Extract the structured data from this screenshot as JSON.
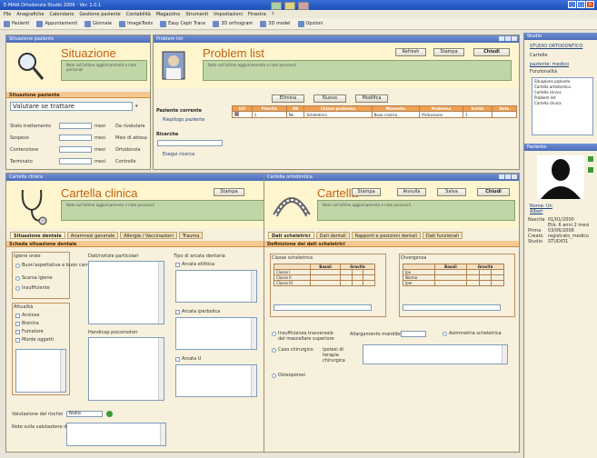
{
  "window": {
    "title": "E-MAIA Ortodonzia Studio 2006 - Ver. 1.0.1"
  },
  "menu": [
    "File",
    "Anagrafiche",
    "Calendario",
    "Gestione paziente",
    "Contabilità",
    "Magazzino",
    "Strumenti",
    "Impostazioni",
    "Finestra",
    "?"
  ],
  "toolbar": [
    "Pazienti",
    "Appuntamenti",
    "Giornale",
    "ImageTools",
    "Easy Ceph Trace",
    "3D orthogram",
    "3D model",
    "Opzioni"
  ],
  "situazione": {
    "pane_title": "Situazione paziente",
    "title": "Situazione paziente",
    "note": "Note sull'ultimo aggiornamento e note personali",
    "section": "Situazione paziente",
    "status_value": "Valutare se trattare",
    "rows": [
      {
        "label": "Stato trattamento",
        "unit": "mesi",
        "right": "Da rivalutare"
      },
      {
        "label": "Sospeso",
        "unit": "mesi",
        "right": "Mesi di attesa"
      },
      {
        "label": "Contenzione",
        "unit": "mesi",
        "right": "Ortodonzia"
      },
      {
        "label": "Terminato",
        "unit": "mesi",
        "right": "Controllo"
      }
    ]
  },
  "problem": {
    "pane_title": "Problem list",
    "title": "Problem list",
    "note": "Note sull'ultimo aggiornamento e note personali",
    "btn_refresh": "Refresh",
    "btn_print": "Stampa",
    "btn_close": "Chiudi",
    "btn_delete": "Elimina",
    "btn_new": "Nuovo",
    "btn_edit": "Modifica",
    "current_label": "Paziente corrente",
    "current_link": "Riepilogo paziente",
    "search_label": "Ricerche",
    "search_link": "Esegui ricerca",
    "headers": [
      "ICU",
      "Priorità",
      "OK",
      "Chiave problema",
      "Momento",
      "Problema",
      "Entità",
      "Note"
    ],
    "rows": [
      [
        "",
        "1",
        "No",
        "Scheletrico",
        "Base cranica",
        "Protrusione",
        "1",
        ""
      ]
    ]
  },
  "clinica": {
    "pane_title": "Cartella clinica",
    "title": "Cartella clinica",
    "note": "Note sull'ultimo aggiornamento e note personali",
    "btn_print": "Stampa",
    "tabs": [
      "Situazione dentale",
      "Anamnesi generale",
      "Allergie / Vaccinazioni",
      "Trauma"
    ],
    "section": "Scheda situazione dentale",
    "grp_igiene": "Igiene orale",
    "igiene_items": [
      "Buon'aspettativa e buon carrello",
      "Scarsa igiene",
      "Insufficiente"
    ],
    "grp_dolori": "Attualità",
    "dolori_items": [
      "Ansiosa",
      "Brontra",
      "Fumatore",
      "Morde oggetti"
    ],
    "lbl_particolari": "Dati/notizie particolari",
    "lbl_handicap": "Handicap psicomotori",
    "lbl_arcata": "Tipo di arcata dentaria",
    "arcata_items": [
      "Arcata ellittica",
      "Arcata iperbolica",
      "Arcata U"
    ],
    "lbl_val_rischio": "Valutazione del rischio",
    "val_rischio": "Nullo",
    "lbl_note_val": "Note sulla valutazione del rischio"
  },
  "ortodontica": {
    "pane_title": "Cartella ortodontica",
    "title": "Cartella",
    "note": "Note sull'ultimo aggiornamento e note personali",
    "btn_print": "Stampa",
    "btn_annulla": "Annulla",
    "btn_salva": "Salva",
    "btn_close": "Chiudi",
    "tabs": [
      "Dati scheletrici",
      "Dati dentali",
      "Rapporti e posizioni dentali",
      "Dati funzionali"
    ],
    "section": "Definizione dei dati scheletrici",
    "grp_classi": "Classe scheletrica",
    "classi_cols": [
      "Basali",
      "Gravità"
    ],
    "classi_rows": [
      "Classe I",
      "Classe II",
      "Classe III"
    ],
    "grp_divergenza": "Divergenza",
    "div_cols": [
      "Basali",
      "Gravità"
    ],
    "div_rows": [
      "Ipo",
      "Normo",
      "Iper"
    ],
    "opt_insuff": "Insufficienza trasversale del mascellare superiore",
    "lbl_allargamento": "Allargamento mandibolare",
    "opt_asimmetria": "Asimmetria scheletrica",
    "opt_chirurgia": "Caso chirurgico",
    "lbl_tipo_chir": "Ipotesi di terapia chirurgica",
    "opt_osteo": "Osteoporosi"
  },
  "right": {
    "title": "Studio",
    "clinic": "STUDIO ORTODONTICO",
    "lbl_cartelle": "Cartelle",
    "sub_title": "paziente: medico",
    "lbl_funzionalita": "Funzionalità",
    "list": [
      "Situazione paziente",
      "Cartella ortodontica",
      "Cartella clinica",
      "Problem list",
      "Cartella clinica"
    ],
    "lbl_paziente": "Paziente",
    "patient_name": "Nome: Un",
    "patient_sub": "Alberi",
    "details": [
      {
        "k": "Nascita",
        "v": "01/01/2000"
      },
      {
        "k": "",
        "v": "Età: 6 anni 2 mesi"
      },
      {
        "k": "Prima",
        "v": "03/06/2006"
      },
      {
        "k": "Creato",
        "v": "registrato_medico"
      },
      {
        "k": "Studio",
        "v": "STUDIO1"
      }
    ]
  },
  "colors": {
    "accent": "#f0a050",
    "title": "#c06010",
    "note_bg": "#bfd7a7",
    "titlebar": "#3a6fd8"
  }
}
